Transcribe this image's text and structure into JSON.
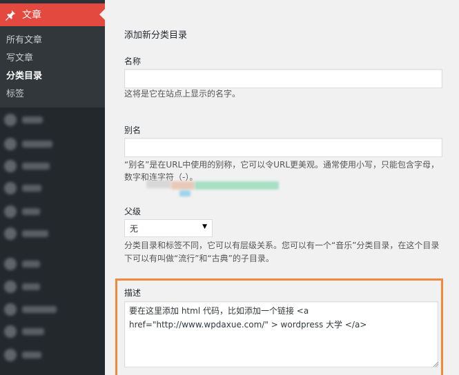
{
  "sidebar": {
    "active_menu_label": "文章",
    "submenu": [
      {
        "label": "所有文章",
        "current": false
      },
      {
        "label": "写文章",
        "current": false
      },
      {
        "label": "分类目录",
        "current": true
      },
      {
        "label": "标签",
        "current": false
      }
    ]
  },
  "form": {
    "heading": "添加新分类目录",
    "name": {
      "label": "名称",
      "value": "",
      "help": "这将是它在站点上显示的名字。"
    },
    "slug": {
      "label": "别名",
      "value": "",
      "help_line1": "“别名”是在URL中使用的别称，它可以令URL更美观。通常使用小写，只能包含字母，",
      "help_line2": "数字和连字符（-）。"
    },
    "parent": {
      "label": "父级",
      "selected": "无",
      "help_line1": "分类目录和标签不同，它可以有层级关系。您可以有一个“音乐”分类目录，在这个目录",
      "help_line2": "下可以有叫做“流行”和“古典”的子目录。"
    },
    "description": {
      "label": "描述",
      "value": "要在这里添加 html 代码，比如添加一个链接 <a\nhref=\"http://www.wpdaxue.com/\" > wordpress 大学 </a>"
    }
  },
  "colors": {
    "sidebar_bg": "#23282d",
    "active_menu": "#e4493f",
    "highlight_border": "#f0883e"
  }
}
